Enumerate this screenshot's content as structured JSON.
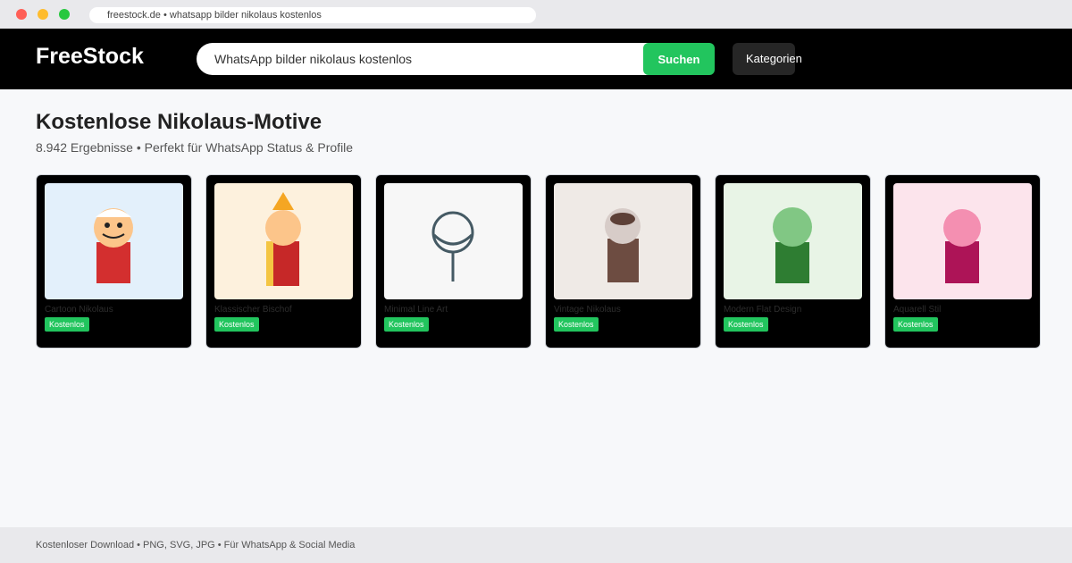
{
  "browser": {
    "url": "freestock.de • whatsapp bilder nikolaus kostenlos"
  },
  "header": {
    "logo": "FreeStock",
    "search_value": "WhatsApp bilder nikolaus kostenlos",
    "search_button": "Suchen",
    "categories_button": "Kategorien"
  },
  "main": {
    "title": "Kostenlose Nikolaus-Motive",
    "subtitle": "8.942 Ergebnisse • Perfekt für WhatsApp Status & Profile"
  },
  "cards": [
    {
      "title": "Cartoon Nikolaus",
      "badge": "Kostenlos",
      "bg": "#e3f0fb"
    },
    {
      "title": "Klassischer Bischof",
      "badge": "Kostenlos",
      "bg": "#fdf1dd"
    },
    {
      "title": "Minimal Line Art",
      "badge": "Kostenlos",
      "bg": "#f7f7f7"
    },
    {
      "title": "Vintage Nikolaus",
      "badge": "Kostenlos",
      "bg": "#efeae6"
    },
    {
      "title": "Modern Flat Design",
      "badge": "Kostenlos",
      "bg": "#e8f4e6"
    },
    {
      "title": "Aquarell Stil",
      "badge": "Kostenlos",
      "bg": "#fce4ec"
    }
  ],
  "footer": {
    "text": "Kostenloser Download • PNG, SVG, JPG • Für WhatsApp & Social Media"
  }
}
